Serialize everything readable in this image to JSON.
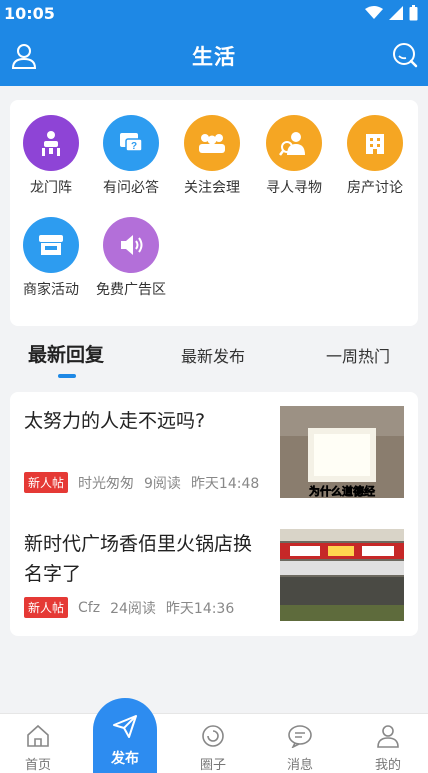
{
  "status": {
    "time": "10:05"
  },
  "header": {
    "title": "生活"
  },
  "categories": [
    {
      "label": "龙门阵",
      "icon": "meeting-icon",
      "color": "#8e44d6"
    },
    {
      "label": "有问必答",
      "icon": "question-icon",
      "color": "#2d9cf0"
    },
    {
      "label": "关注会理",
      "icon": "group-icon",
      "color": "#f5a623"
    },
    {
      "label": "寻人寻物",
      "icon": "search-person-icon",
      "color": "#f5a623"
    },
    {
      "label": "房产讨论",
      "icon": "building-icon",
      "color": "#f5a623"
    },
    {
      "label": "商家活动",
      "icon": "store-icon",
      "color": "#2d9cf0"
    },
    {
      "label": "免费广告区",
      "icon": "speaker-icon",
      "color": "#b36fd9"
    }
  ],
  "tabs": [
    {
      "label": "最新回复",
      "active": true
    },
    {
      "label": "最新发布",
      "active": false
    },
    {
      "label": "一周热门",
      "active": false
    }
  ],
  "posts": [
    {
      "title": "太努力的人走不远吗?",
      "badge": "新人帖",
      "author": "时光匆匆",
      "reads": "9阅读",
      "time": "昨天14:48",
      "thumb_caption": "为什么道德经"
    },
    {
      "title": "新时代广场香佰里火锅店换名字了",
      "badge": "新人帖",
      "author": "Cfz",
      "reads": "24阅读",
      "time": "昨天14:36"
    }
  ],
  "bottom_nav": [
    {
      "label": "首页",
      "icon": "home-icon"
    },
    {
      "label": "发布",
      "icon": "send-icon"
    },
    {
      "label": "圈子",
      "icon": "circle-icon"
    },
    {
      "label": "消息",
      "icon": "chat-icon"
    },
    {
      "label": "我的",
      "icon": "user-icon"
    }
  ]
}
